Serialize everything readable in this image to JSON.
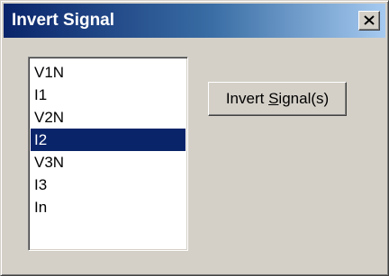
{
  "window": {
    "title": "Invert Signal",
    "close_icon": "close-icon"
  },
  "signal_list": {
    "items": [
      {
        "label": "V1N",
        "selected": false
      },
      {
        "label": "I1",
        "selected": false
      },
      {
        "label": "V2N",
        "selected": false
      },
      {
        "label": "I2",
        "selected": true
      },
      {
        "label": "V3N",
        "selected": false
      },
      {
        "label": "I3",
        "selected": false
      },
      {
        "label": "In",
        "selected": false
      }
    ]
  },
  "invert_button": {
    "label_before": "Invert ",
    "label_mnemonic": "S",
    "label_after": "ignal(s)"
  },
  "colors": {
    "selection": "#0a246a",
    "title_bar_start": "#0a246a",
    "title_bar_end": "#a6caf0",
    "face": "#d4d0c8"
  }
}
